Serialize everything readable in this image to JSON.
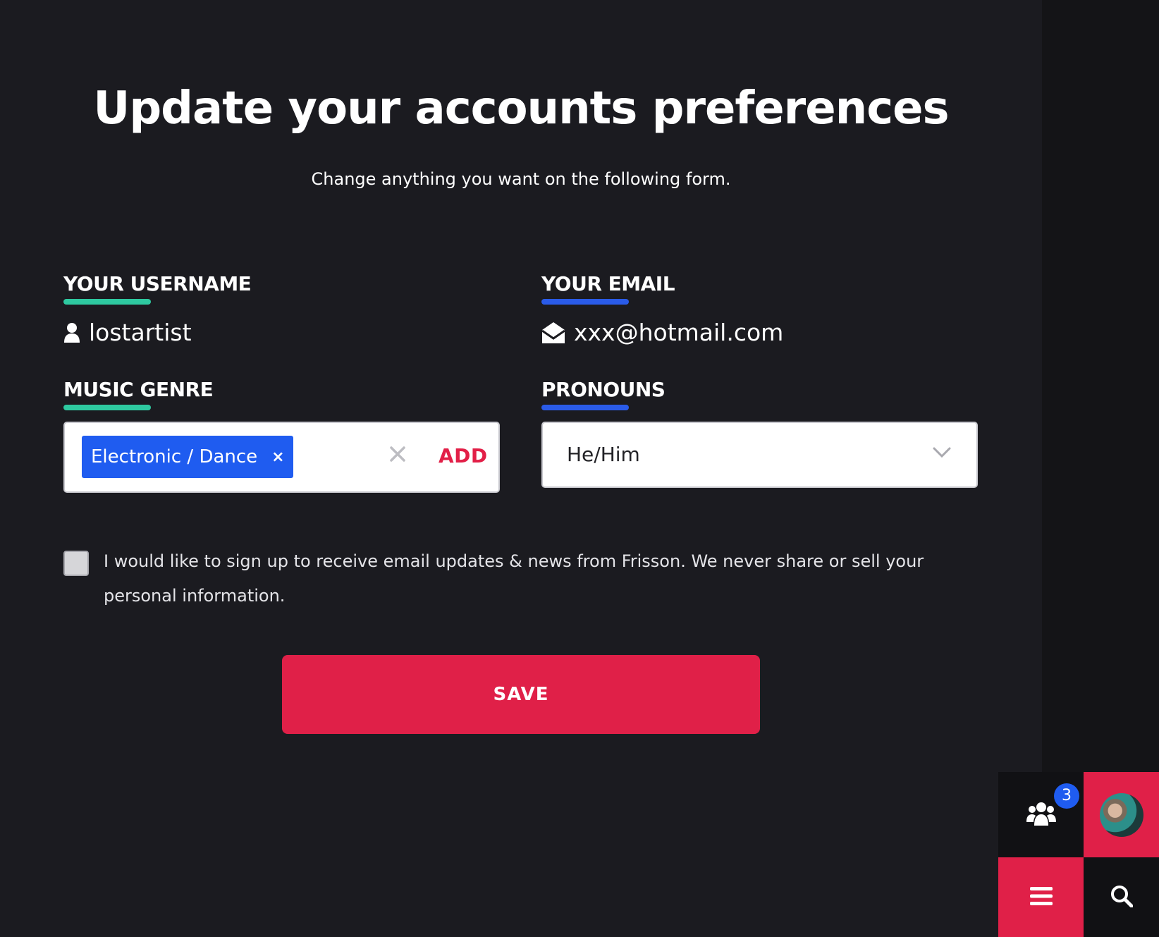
{
  "page": {
    "title": "Update your accounts preferences",
    "subtitle": "Change anything you want on the following form."
  },
  "fields": {
    "username": {
      "label": "YOUR USERNAME",
      "value": "lostartist",
      "icon": "user-icon"
    },
    "email": {
      "label": "YOUR EMAIL",
      "value": "xxx@hotmail.com",
      "icon": "envelope-open-icon"
    },
    "music_genre": {
      "label": "MUSIC GENRE",
      "selected_tag": "Electronic / Dance",
      "tag_remove": "×",
      "add_label": "ADD"
    },
    "pronouns": {
      "label": "PRONOUNS",
      "value": "He/Him"
    }
  },
  "consent": {
    "checked": false,
    "text": "I would like to sign up to receive email updates & news from Frisson. We never share or sell your personal information."
  },
  "save_button": {
    "label": "SAVE"
  },
  "dock": {
    "friends_badge": "3",
    "icons": [
      "users-icon",
      "avatar",
      "hamburger-menu-icon",
      "search-icon"
    ]
  },
  "colors": {
    "background": "#1b1b20",
    "accent_red": "#e02048",
    "accent_blue": "#1f5cf0",
    "accent_green": "#2ec9a0"
  }
}
